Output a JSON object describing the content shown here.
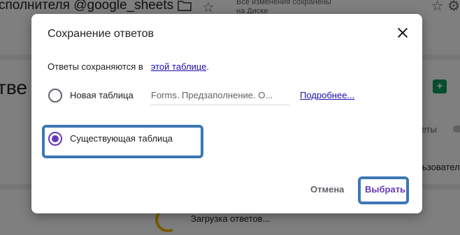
{
  "background": {
    "doc_title": "сполнителя @google_sheets",
    "save_status": "Все изменения сохранены\nна Диске",
    "heading": "тве",
    "sheets_icon": "table-icon",
    "right_text_1": "веты",
    "right_text_2": "ьзовател",
    "loading_text": "Загрузка ответов..."
  },
  "dialog": {
    "title": "Сохранение ответов",
    "info_text": "Ответы сохраняются в",
    "info_link": "этой таблице",
    "info_end": ".",
    "options": [
      {
        "label": "Новая таблица",
        "checked": false
      },
      {
        "label": "Существующая таблица",
        "checked": true
      }
    ],
    "new_sheet_name": "Forms. Предзаполнение. О...",
    "more_link": "Подробнее...",
    "cancel_label": "Отмена",
    "select_label": "Выбрать"
  },
  "colors": {
    "accent": "#673ab7",
    "link": "#1a0dab",
    "highlight": "#3c78b4"
  }
}
